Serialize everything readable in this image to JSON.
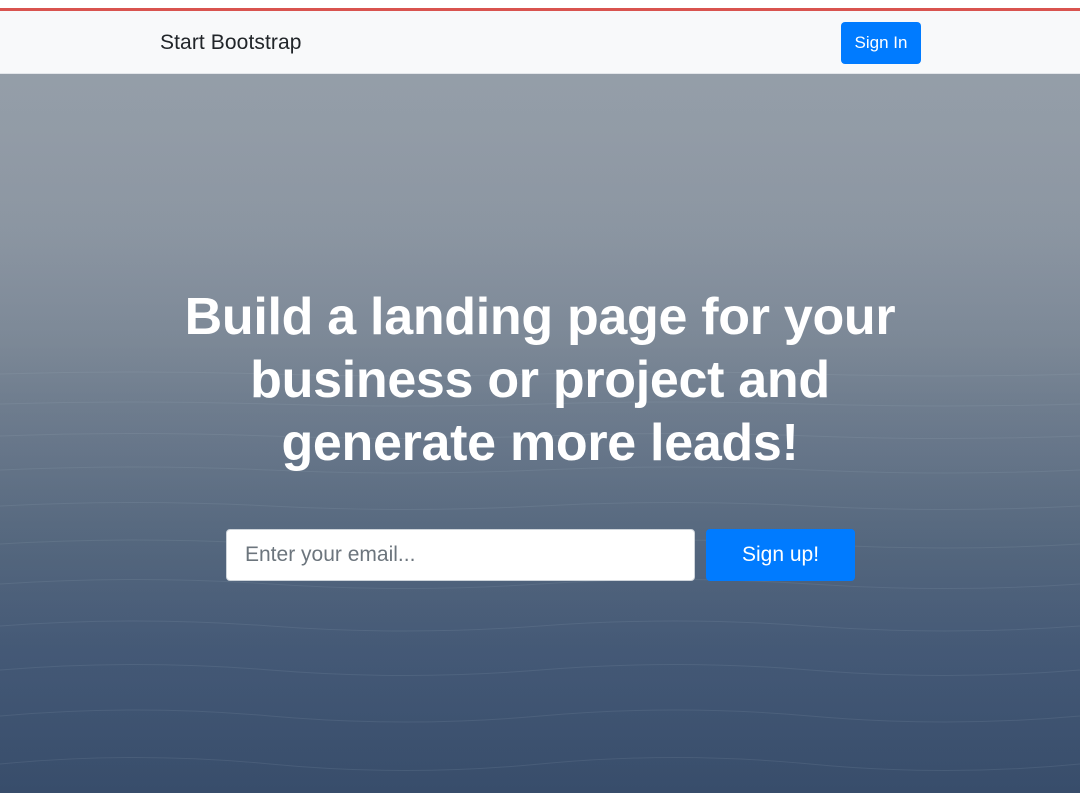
{
  "navbar": {
    "brand": "Start Bootstrap",
    "signin_label": "Sign In"
  },
  "hero": {
    "title": "Build a landing page for your business or project and generate more leads!",
    "email_placeholder": "Enter your email...",
    "email_value": "",
    "signup_label": "Sign up!"
  },
  "colors": {
    "accent_bar": "#d9534f",
    "primary_button": "#007bff",
    "navbar_bg": "#f8f9fa",
    "hero_text": "#ffffff"
  }
}
